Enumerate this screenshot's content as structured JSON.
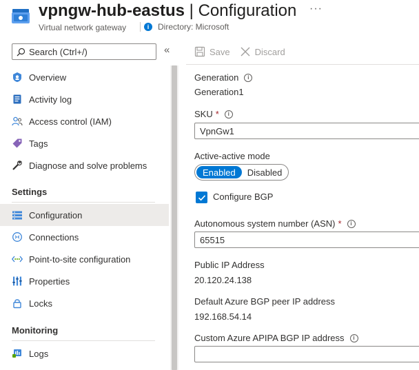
{
  "header": {
    "resource_name": "vpngw-hub-eastus",
    "separator": " | ",
    "blade_title": "Configuration",
    "more_label": "···",
    "resource_type": "Virtual network gateway",
    "directory": "Directory: Microsoft",
    "info_glyph": "i"
  },
  "search": {
    "placeholder": "Search (Ctrl+/)",
    "collapse_label": "«"
  },
  "nav": {
    "items": [
      {
        "label": "Overview",
        "icon": "vpn-gateway-icon"
      },
      {
        "label": "Activity log",
        "icon": "activity-log-icon"
      },
      {
        "label": "Access control (IAM)",
        "icon": "people-icon"
      },
      {
        "label": "Tags",
        "icon": "tag-icon"
      },
      {
        "label": "Diagnose and solve problems",
        "icon": "wrench-icon"
      }
    ],
    "sections": [
      {
        "title": "Settings",
        "items": [
          {
            "label": "Configuration",
            "icon": "configuration-icon",
            "active": true
          },
          {
            "label": "Connections",
            "icon": "connections-icon"
          },
          {
            "label": "Point-to-site configuration",
            "icon": "point-to-site-icon"
          },
          {
            "label": "Properties",
            "icon": "properties-icon"
          },
          {
            "label": "Locks",
            "icon": "lock-icon"
          }
        ]
      },
      {
        "title": "Monitoring",
        "items": [
          {
            "label": "Logs",
            "icon": "logs-icon"
          }
        ]
      }
    ]
  },
  "toolbar": {
    "save_label": "Save",
    "discard_label": "Discard"
  },
  "form": {
    "generation_label": "Generation",
    "generation_value": "Generation1",
    "sku_label": "SKU",
    "sku_value": "VpnGw1",
    "required_mark": "*",
    "active_active_label": "Active-active mode",
    "toggle_enabled": "Enabled",
    "toggle_disabled": "Disabled",
    "active_active_value": "Enabled",
    "bgp_label": "Configure BGP",
    "bgp_checked": true,
    "asn_label": "Autonomous system number (ASN)",
    "asn_value": "65515",
    "public_ip_label": "Public IP Address",
    "public_ip_value": "20.120.24.138",
    "bgp_peer_label": "Default Azure BGP peer IP address",
    "bgp_peer_value": "192.168.54.14",
    "apipa_label": "Custom Azure APIPA BGP IP address",
    "apipa_value": "",
    "info_glyph": "i"
  },
  "colors": {
    "accent": "#0078d4",
    "active_nav_bg": "#edebe9",
    "required": "#a4262c"
  }
}
